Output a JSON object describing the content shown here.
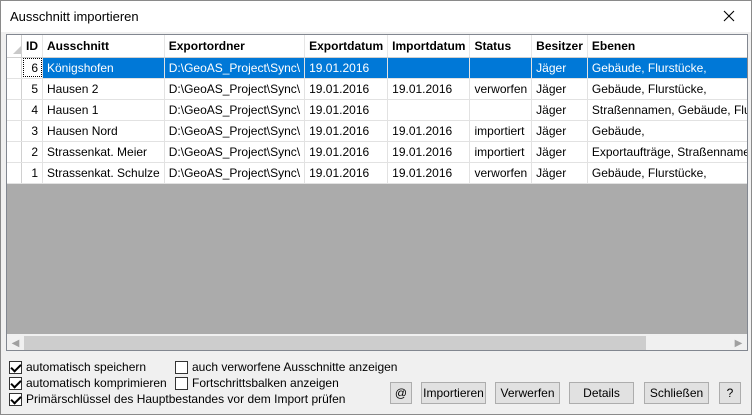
{
  "window": {
    "title": "Ausschnitt importieren"
  },
  "grid": {
    "columns": [
      "ID",
      "Ausschnitt",
      "Exportordner",
      "Exportdatum",
      "Importdatum",
      "Status",
      "Besitzer",
      "Ebenen"
    ],
    "rows": [
      {
        "id": "6",
        "ausschnitt": "Königshofen",
        "exportordner": "D:\\GeoAS_Project\\Sync\\",
        "exportdatum": "19.01.2016",
        "importdatum": "",
        "status": "",
        "besitzer": "Jäger",
        "ebenen": "Gebäude, Flurstücke,",
        "selected": true
      },
      {
        "id": "5",
        "ausschnitt": "Hausen 2",
        "exportordner": "D:\\GeoAS_Project\\Sync\\",
        "exportdatum": "19.01.2016",
        "importdatum": "19.01.2016",
        "status": "verworfen",
        "besitzer": "Jäger",
        "ebenen": "Gebäude, Flurstücke,"
      },
      {
        "id": "4",
        "ausschnitt": "Hausen 1",
        "exportordner": "D:\\GeoAS_Project\\Sync\\",
        "exportdatum": "19.01.2016",
        "importdatum": "",
        "status": "",
        "besitzer": "Jäger",
        "ebenen": "Straßennamen, Gebäude, Flurst"
      },
      {
        "id": "3",
        "ausschnitt": "Hausen Nord",
        "exportordner": "D:\\GeoAS_Project\\Sync\\",
        "exportdatum": "19.01.2016",
        "importdatum": "19.01.2016",
        "status": "importiert",
        "besitzer": "Jäger",
        "ebenen": "Gebäude,"
      },
      {
        "id": "2",
        "ausschnitt": "Strassenkat. Meier",
        "exportordner": "D:\\GeoAS_Project\\Sync\\",
        "exportdatum": "19.01.2016",
        "importdatum": "19.01.2016",
        "status": "importiert",
        "besitzer": "Jäger",
        "ebenen": "Exportaufträge, Straßennamen,"
      },
      {
        "id": "1",
        "ausschnitt": "Strassenkat. Schulze",
        "exportordner": "D:\\GeoAS_Project\\Sync\\",
        "exportdatum": "19.01.2016",
        "importdatum": "19.01.2016",
        "status": "verworfen",
        "besitzer": "Jäger",
        "ebenen": "Gebäude, Flurstücke,"
      }
    ]
  },
  "options": {
    "auto_save": {
      "label": "automatisch speichern",
      "checked": true
    },
    "auto_compress": {
      "label": "automatisch komprimieren",
      "checked": true
    },
    "check_primary_key": {
      "label": "Primärschlüssel des Hauptbestandes vor dem Import prüfen",
      "checked": true
    },
    "show_rejected": {
      "label": "auch verworfene Ausschnitte anzeigen",
      "checked": false
    },
    "show_progress": {
      "label": "Fortschrittsbalken anzeigen",
      "checked": false
    }
  },
  "buttons": {
    "at": "@",
    "import": "Importieren",
    "reject": "Verwerfen",
    "details": "Details",
    "close": "Schließen",
    "help": "?"
  },
  "colors": {
    "selection": "#0078d7",
    "grid_background": "#ababab"
  }
}
